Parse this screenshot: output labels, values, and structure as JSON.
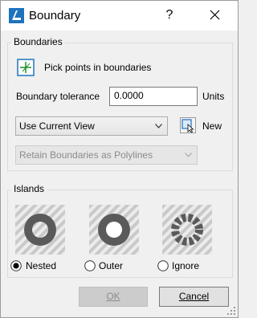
{
  "window": {
    "title": "Boundary",
    "help_label": "?",
    "icons": {
      "app": "app-logo-icon",
      "close": "close-icon"
    }
  },
  "boundaries": {
    "group_label": "Boundaries",
    "pick_points_label": "Pick points in boundaries",
    "pick_icon": "pick-points-icon",
    "tolerance_label": "Boundary tolerance",
    "tolerance_value": "0.0000",
    "tolerance_units": "Units",
    "view_set_selected": "Use Current View",
    "new_label": "New",
    "new_icon": "select-objects-icon",
    "retain_selected": "Retain Boundaries as Polylines"
  },
  "islands": {
    "group_label": "Islands",
    "options": [
      {
        "label": "Nested",
        "selected": true,
        "icon": "island-nested-icon"
      },
      {
        "label": "Outer",
        "selected": false,
        "icon": "island-outer-icon"
      },
      {
        "label": "Ignore",
        "selected": false,
        "icon": "island-ignore-icon"
      }
    ]
  },
  "buttons": {
    "ok_label": "OK",
    "cancel_label": "Cancel"
  },
  "colors": {
    "app_icon_blue": "#1e73be",
    "ring_gray": "#5a5a5a",
    "pick_icon_green": "#1c8f2a"
  }
}
